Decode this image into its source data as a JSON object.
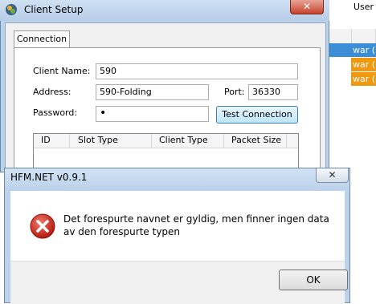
{
  "background": {
    "user_header": "User",
    "rows": [
      "war (3",
      "war (3",
      "war (3"
    ],
    "row_colors": [
      "#3b8dd6",
      "#f0980f",
      "#f0980f"
    ]
  },
  "client_setup": {
    "title": "Client Setup",
    "close_glyph": "✕",
    "tabs": [
      {
        "label": "Connection"
      }
    ],
    "fields": {
      "client_name_label": "Client Name:",
      "client_name_value": "590",
      "address_label": "Address:",
      "address_value": "590-Folding",
      "port_label": "Port:",
      "port_value": "36330",
      "password_label": "Password:",
      "password_value": "•"
    },
    "test_button": "Test Connection",
    "slot_columns": [
      "ID",
      "Slot Type",
      "Client Type",
      "Packet Size"
    ]
  },
  "dialog": {
    "title": "HFM.NET v0.9.1",
    "close_glyph": "✕",
    "icon": "error-icon",
    "message": "Det forespurte navnet er gyldig, men finner ingen data av den forespurte typen",
    "ok_button": "OK"
  }
}
